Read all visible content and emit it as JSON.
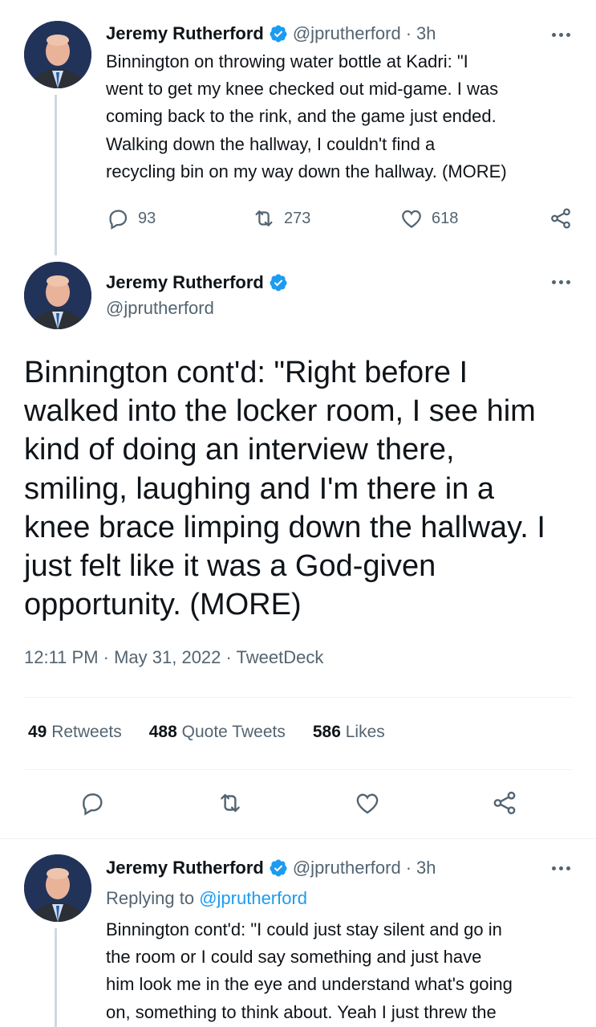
{
  "author": {
    "name": "Jeremy Rutherford",
    "handle": "@jprutherford"
  },
  "tweet1": {
    "time": "3h",
    "lines": [
      "Binnington on throwing water bottle at Kadri: \"I",
      "went to get my knee checked out mid-game. I was",
      "coming back to the rink, and the game just ended.",
      "Walking down the hallway, I couldn't find a",
      "recycling bin on my way down the hallway. (MORE)"
    ],
    "replies": "93",
    "retweets": "273",
    "likes": "618"
  },
  "tweet2": {
    "lines": [
      "Binnington cont'd: \"Right before I",
      "walked into the locker room, I see him",
      "kind of doing an interview there,",
      "smiling, laughing and I'm there in a",
      "knee brace limping down the hallway. I",
      "just felt like it was a God-given",
      "opportunity. (MORE)"
    ],
    "meta": "12:11 PM · May 31, 2022 · TweetDeck",
    "stats": {
      "retweets_count": "49",
      "retweets_label": "Retweets",
      "quotes_count": "488",
      "quotes_label": "Quote Tweets",
      "likes_count": "586",
      "likes_label": "Likes"
    }
  },
  "tweet3": {
    "time": "3h",
    "replying_prefix": "Replying to",
    "replying_to": "@jprutherford",
    "lines": [
      "Binnington cont'd: \"I could just stay silent and go in",
      "the room or I could say something and just have",
      "him look me in the eye and understand what's going",
      "on, something to think about. Yeah I just threw the"
    ]
  },
  "colors": {
    "text": "#0f1419",
    "secondary": "#536471",
    "accent": "#1d9bf0",
    "divider": "#eff3f4"
  }
}
